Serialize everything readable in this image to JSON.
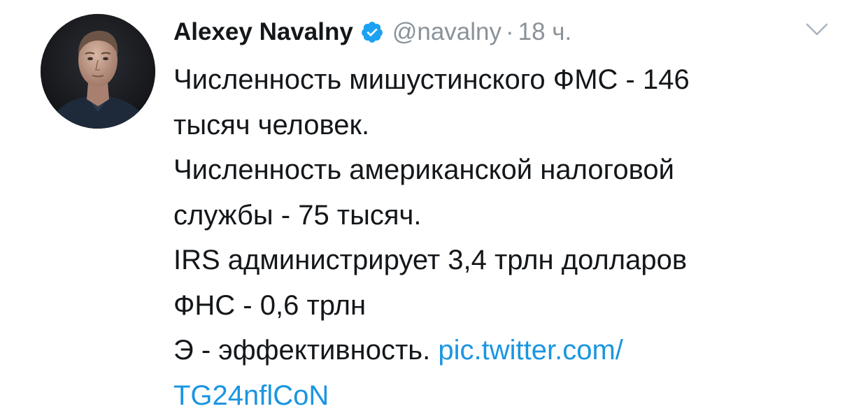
{
  "tweet": {
    "author_name": "Alexey Navalny",
    "handle": "@navalny",
    "separator": "·",
    "time": "18 ч.",
    "lines": [
      "Численность мишустинского ФМС - 146",
      "тысяч человек.",
      "Численность американской налоговой",
      "службы - 75 тысяч.",
      "IRS администрирует 3,4 трлн долларов",
      "ФНС - 0,6 трлн"
    ],
    "last_line_text": "Э - эффективность. ",
    "link_part1": "pic.twitter.com/",
    "link_part2": "TG24nflCoN"
  },
  "icons": {
    "verified": "verified-badge-icon",
    "chevron": "chevron-down-icon"
  },
  "colors": {
    "text": "#14171a",
    "secondary": "#8a9299",
    "link": "#1b95e0",
    "verified": "#1da1f2"
  }
}
